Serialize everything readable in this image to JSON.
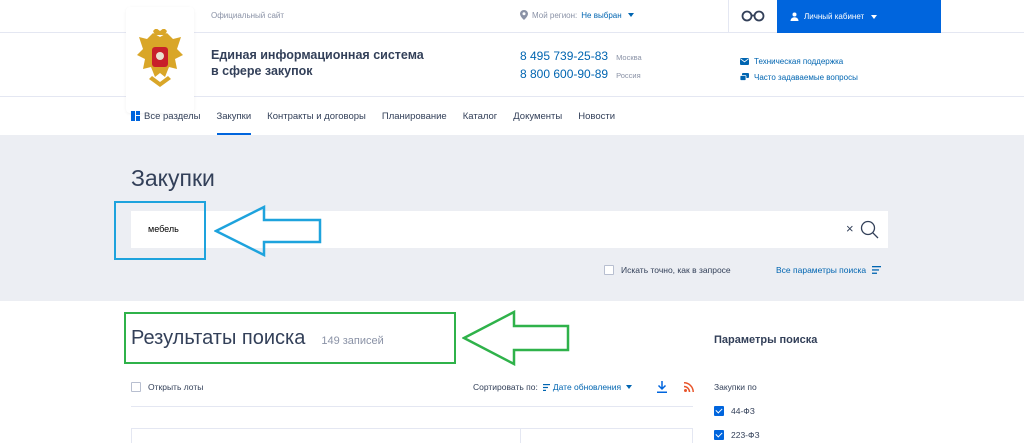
{
  "topbar": {
    "official_site": "Официальный сайт",
    "region_label": "Мой регион:",
    "region_value": "Не выбран",
    "cabinet_label": "Личный кабинет"
  },
  "header": {
    "system_name_line1": "Единая информационная система",
    "system_name_line2": "в сфере закупок",
    "phones": [
      {
        "number": "8 495 739-25-83",
        "city": "Москва"
      },
      {
        "number": "8 800 600-90-89",
        "city": "Россия"
      }
    ],
    "support": [
      {
        "label": "Техническая поддержка",
        "icon": "mail-icon"
      },
      {
        "label": "Часто задаваемые вопросы",
        "icon": "chat-icon"
      }
    ]
  },
  "nav": {
    "items": [
      {
        "label": "Все разделы",
        "active": false
      },
      {
        "label": "Закупки",
        "active": true
      },
      {
        "label": "Контракты и договоры",
        "active": false
      },
      {
        "label": "Планирование",
        "active": false
      },
      {
        "label": "Каталог",
        "active": false
      },
      {
        "label": "Документы",
        "active": false
      },
      {
        "label": "Новости",
        "active": false
      }
    ]
  },
  "search": {
    "page_title": "Закупки",
    "query": "мебель",
    "clear": "×",
    "exact_label": "Искать точно, как в запросе",
    "all_params_label": "Все параметры поиска"
  },
  "results": {
    "title": "Результаты поиска",
    "count": "149 записей",
    "open_lots_label": "Открыть лоты",
    "sort_label": "Сортировать по:",
    "sort_value": "Дате обновления"
  },
  "params": {
    "title": "Параметры поиска",
    "group_label": "Закупки по",
    "filters": [
      {
        "label": "44-ФЗ",
        "checked": true
      },
      {
        "label": "223-ФЗ",
        "checked": true
      }
    ]
  },
  "colors": {
    "accent": "#0065dd",
    "link": "#0065b1",
    "panel_bg": "#eceef3",
    "annotation_blue": "#1ea3dd",
    "annotation_green": "#2fb24a",
    "rss": "#e8542a"
  }
}
